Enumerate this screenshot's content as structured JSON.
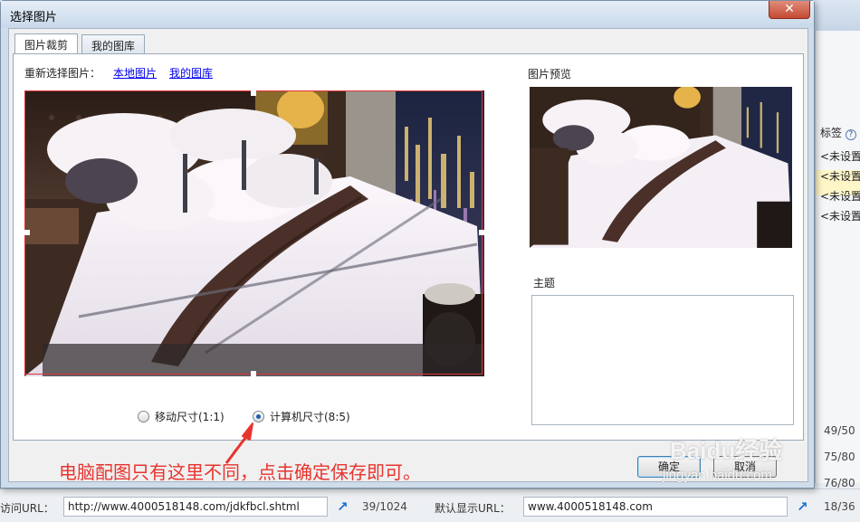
{
  "background": {
    "tag_header": "标签",
    "tag_items": [
      "<未设置",
      "<未设置",
      "<未设置",
      "<未设置"
    ],
    "ratios": [
      "49/50",
      "75/80",
      "76/80"
    ],
    "bottom": {
      "visit_url_label": "访问URL：",
      "visit_url_value": "http://www.4000518148.com/jdkfbcl.shtml",
      "visit_url_count": "39/1024",
      "default_url_label": "默认显示URL：",
      "default_url_value": "www.4000518148.com",
      "default_url_count": "18/36"
    }
  },
  "dialog": {
    "title": "选择图片",
    "close_label": "✕",
    "tabs": [
      {
        "label": "图片裁剪",
        "active": true
      },
      {
        "label": "我的图库",
        "active": false
      }
    ],
    "reselect": {
      "label": "重新选择图片：",
      "link_local": "本地图片",
      "link_gallery": "我的图库"
    },
    "preview_label": "图片预览",
    "subject_label": "主题",
    "subject_value": "",
    "radio_options": [
      {
        "label": "移动尺寸(1:1)",
        "checked": false
      },
      {
        "label": "计算机尺寸(8:5)",
        "checked": true
      }
    ],
    "buttons": {
      "confirm": "确定",
      "cancel": "取消"
    }
  },
  "annotation": "电脑配图只有这里不同，点击确定保存即可。",
  "watermark": {
    "brand": "Baidu经验",
    "site": "jingyan.baidu.com"
  },
  "colors": {
    "annotation": "#e8342e",
    "crop_border": "#e0343a",
    "link": "#0000ee",
    "radio_dot": "#1a5fb4"
  }
}
